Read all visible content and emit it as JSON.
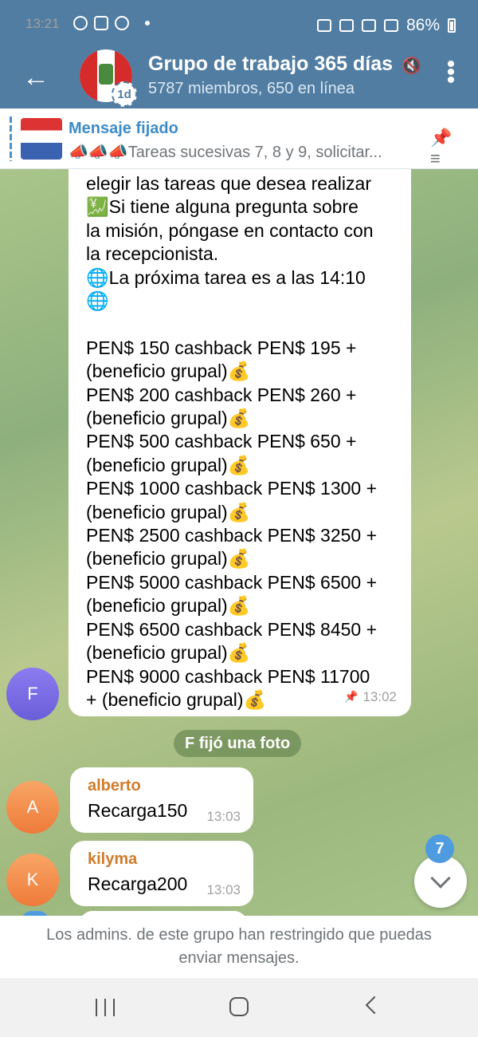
{
  "status_bar": {
    "time": "13:21",
    "battery": "86%"
  },
  "header": {
    "back_icon": "arrow-left-icon",
    "title": "Grupo de trabajo 365 días",
    "subtitle": "5787 miembros, 650 en línea",
    "avatar_badge": "1d",
    "mute_icon": "muted-icon",
    "menu_icon": "more-vertical-icon"
  },
  "pinned": {
    "title": "Mensaje fijado",
    "text": "📣📣📣Tareas sucesivas 7, 8 y 9, solicitar...",
    "icon": "pin-list-icon"
  },
  "chat": {
    "main_message": {
      "lines": [
        "elegir las tareas que desea realizar",
        "💹Si tiene alguna pregunta sobre",
        "la misión, póngase en contacto con",
        "la recepcionista.",
        "🌐La próxima tarea es a las 14:10",
        "🌐",
        "",
        "PEN$ 150 cashback PEN$ 195 +",
        "(beneficio grupal)💰",
        "PEN$ 200 cashback PEN$ 260 +",
        "(beneficio grupal)💰",
        "PEN$ 500 cashback PEN$ 650 +",
        "(beneficio grupal)💰",
        "PEN$ 1000 cashback PEN$ 1300 +",
        "(beneficio grupal)💰",
        "PEN$ 2500 cashback PEN$ 3250 +",
        "(beneficio grupal)💰",
        "PEN$ 5000 cashback PEN$ 6500 +",
        "(beneficio grupal)💰",
        "PEN$ 6500 cashback PEN$ 8450 +",
        "(beneficio grupal)💰",
        "PEN$ 9000 cashback PEN$ 11700",
        "+ (beneficio grupal)💰"
      ],
      "time": "13:02",
      "sender_initial": "F"
    },
    "service_message": "F fijó una foto",
    "messages": [
      {
        "initial": "A",
        "name": "alberto",
        "text": "Recarga150",
        "time": "13:03"
      },
      {
        "initial": "K",
        "name": "kilyma",
        "text": "Recarga200",
        "time": "13:03"
      }
    ],
    "unread_count": "7"
  },
  "footer": {
    "restriction_line1": "Los admins. de este grupo han restringido que puedas",
    "restriction_line2": "enviar mensajes."
  }
}
